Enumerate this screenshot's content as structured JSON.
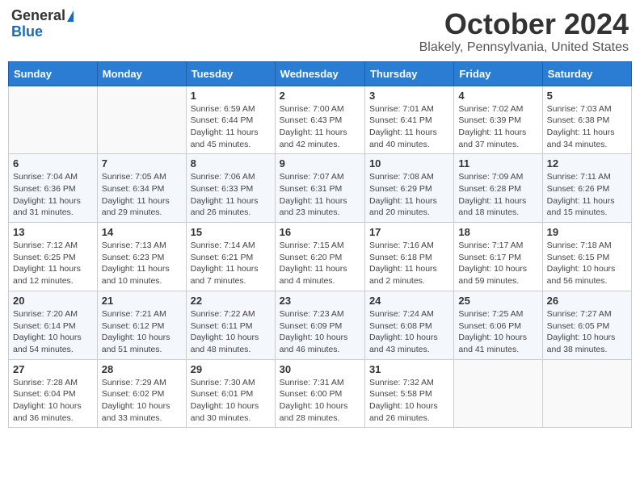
{
  "header": {
    "logo_general": "General",
    "logo_blue": "Blue",
    "month_title": "October 2024",
    "location": "Blakely, Pennsylvania, United States"
  },
  "days_of_week": [
    "Sunday",
    "Monday",
    "Tuesday",
    "Wednesday",
    "Thursday",
    "Friday",
    "Saturday"
  ],
  "weeks": [
    [
      {
        "day": "",
        "detail": ""
      },
      {
        "day": "",
        "detail": ""
      },
      {
        "day": "1",
        "detail": "Sunrise: 6:59 AM\nSunset: 6:44 PM\nDaylight: 11 hours and 45 minutes."
      },
      {
        "day": "2",
        "detail": "Sunrise: 7:00 AM\nSunset: 6:43 PM\nDaylight: 11 hours and 42 minutes."
      },
      {
        "day": "3",
        "detail": "Sunrise: 7:01 AM\nSunset: 6:41 PM\nDaylight: 11 hours and 40 minutes."
      },
      {
        "day": "4",
        "detail": "Sunrise: 7:02 AM\nSunset: 6:39 PM\nDaylight: 11 hours and 37 minutes."
      },
      {
        "day": "5",
        "detail": "Sunrise: 7:03 AM\nSunset: 6:38 PM\nDaylight: 11 hours and 34 minutes."
      }
    ],
    [
      {
        "day": "6",
        "detail": "Sunrise: 7:04 AM\nSunset: 6:36 PM\nDaylight: 11 hours and 31 minutes."
      },
      {
        "day": "7",
        "detail": "Sunrise: 7:05 AM\nSunset: 6:34 PM\nDaylight: 11 hours and 29 minutes."
      },
      {
        "day": "8",
        "detail": "Sunrise: 7:06 AM\nSunset: 6:33 PM\nDaylight: 11 hours and 26 minutes."
      },
      {
        "day": "9",
        "detail": "Sunrise: 7:07 AM\nSunset: 6:31 PM\nDaylight: 11 hours and 23 minutes."
      },
      {
        "day": "10",
        "detail": "Sunrise: 7:08 AM\nSunset: 6:29 PM\nDaylight: 11 hours and 20 minutes."
      },
      {
        "day": "11",
        "detail": "Sunrise: 7:09 AM\nSunset: 6:28 PM\nDaylight: 11 hours and 18 minutes."
      },
      {
        "day": "12",
        "detail": "Sunrise: 7:11 AM\nSunset: 6:26 PM\nDaylight: 11 hours and 15 minutes."
      }
    ],
    [
      {
        "day": "13",
        "detail": "Sunrise: 7:12 AM\nSunset: 6:25 PM\nDaylight: 11 hours and 12 minutes."
      },
      {
        "day": "14",
        "detail": "Sunrise: 7:13 AM\nSunset: 6:23 PM\nDaylight: 11 hours and 10 minutes."
      },
      {
        "day": "15",
        "detail": "Sunrise: 7:14 AM\nSunset: 6:21 PM\nDaylight: 11 hours and 7 minutes."
      },
      {
        "day": "16",
        "detail": "Sunrise: 7:15 AM\nSunset: 6:20 PM\nDaylight: 11 hours and 4 minutes."
      },
      {
        "day": "17",
        "detail": "Sunrise: 7:16 AM\nSunset: 6:18 PM\nDaylight: 11 hours and 2 minutes."
      },
      {
        "day": "18",
        "detail": "Sunrise: 7:17 AM\nSunset: 6:17 PM\nDaylight: 10 hours and 59 minutes."
      },
      {
        "day": "19",
        "detail": "Sunrise: 7:18 AM\nSunset: 6:15 PM\nDaylight: 10 hours and 56 minutes."
      }
    ],
    [
      {
        "day": "20",
        "detail": "Sunrise: 7:20 AM\nSunset: 6:14 PM\nDaylight: 10 hours and 54 minutes."
      },
      {
        "day": "21",
        "detail": "Sunrise: 7:21 AM\nSunset: 6:12 PM\nDaylight: 10 hours and 51 minutes."
      },
      {
        "day": "22",
        "detail": "Sunrise: 7:22 AM\nSunset: 6:11 PM\nDaylight: 10 hours and 48 minutes."
      },
      {
        "day": "23",
        "detail": "Sunrise: 7:23 AM\nSunset: 6:09 PM\nDaylight: 10 hours and 46 minutes."
      },
      {
        "day": "24",
        "detail": "Sunrise: 7:24 AM\nSunset: 6:08 PM\nDaylight: 10 hours and 43 minutes."
      },
      {
        "day": "25",
        "detail": "Sunrise: 7:25 AM\nSunset: 6:06 PM\nDaylight: 10 hours and 41 minutes."
      },
      {
        "day": "26",
        "detail": "Sunrise: 7:27 AM\nSunset: 6:05 PM\nDaylight: 10 hours and 38 minutes."
      }
    ],
    [
      {
        "day": "27",
        "detail": "Sunrise: 7:28 AM\nSunset: 6:04 PM\nDaylight: 10 hours and 36 minutes."
      },
      {
        "day": "28",
        "detail": "Sunrise: 7:29 AM\nSunset: 6:02 PM\nDaylight: 10 hours and 33 minutes."
      },
      {
        "day": "29",
        "detail": "Sunrise: 7:30 AM\nSunset: 6:01 PM\nDaylight: 10 hours and 30 minutes."
      },
      {
        "day": "30",
        "detail": "Sunrise: 7:31 AM\nSunset: 6:00 PM\nDaylight: 10 hours and 28 minutes."
      },
      {
        "day": "31",
        "detail": "Sunrise: 7:32 AM\nSunset: 5:58 PM\nDaylight: 10 hours and 26 minutes."
      },
      {
        "day": "",
        "detail": ""
      },
      {
        "day": "",
        "detail": ""
      }
    ]
  ]
}
